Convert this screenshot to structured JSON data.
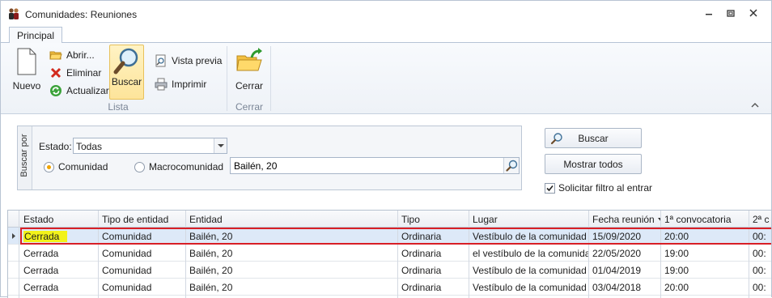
{
  "window": {
    "title": "Comunidades: Reuniones"
  },
  "ribbon": {
    "tab": "Principal",
    "nuevo": "Nuevo",
    "abrir": "Abrir...",
    "eliminar": "Eliminar",
    "actualizar": "Actualizar",
    "buscar": "Buscar",
    "vista_previa": "Vista previa",
    "imprimir": "Imprimir",
    "cerrar": "Cerrar",
    "group_lista": "Lista",
    "group_cerrar": "Cerrar"
  },
  "filter": {
    "side_label": "Buscar por",
    "estado_label": "Estado:",
    "estado_value": "Todas",
    "radio_comunidad": "Comunidad",
    "radio_macro": "Macrocomunidad",
    "search_value": "Bailén, 20",
    "btn_buscar": "Buscar",
    "btn_mostrar": "Mostrar todos",
    "chk_solicitar": "Solicitar filtro al entrar"
  },
  "grid": {
    "columns": [
      "Estado",
      "Tipo de entidad",
      "Entidad",
      "Tipo",
      "Lugar",
      "Fecha reunión",
      "1ª convocatoria",
      "2ª c"
    ],
    "rows": [
      [
        "Cerrada",
        "Comunidad",
        "Bailén, 20",
        "Ordinaria",
        "Vestíbulo de la comunidad",
        "15/09/2020",
        "20:00",
        "00:"
      ],
      [
        "Cerrada",
        "Comunidad",
        "Bailén, 20",
        "Ordinaria",
        "el vestíbulo de la comunidad",
        "22/05/2020",
        "19:00",
        "00:"
      ],
      [
        "Cerrada",
        "Comunidad",
        "Bailén, 20",
        "Ordinaria",
        "Vestíbulo de la comunidad",
        "01/04/2019",
        "19:00",
        "00:"
      ],
      [
        "Cerrada",
        "Comunidad",
        "Bailén, 20",
        "Ordinaria",
        "Vestíbulo de la comunidad",
        "03/04/2018",
        "20:00",
        "00:"
      ],
      [
        "",
        "",
        "",
        "",
        "",
        "",
        "",
        ""
      ]
    ]
  },
  "colors": {
    "selection_outline": "#d81f26",
    "highlight_yellow": "#f2f21a",
    "selected_row": "#dde9f8"
  }
}
